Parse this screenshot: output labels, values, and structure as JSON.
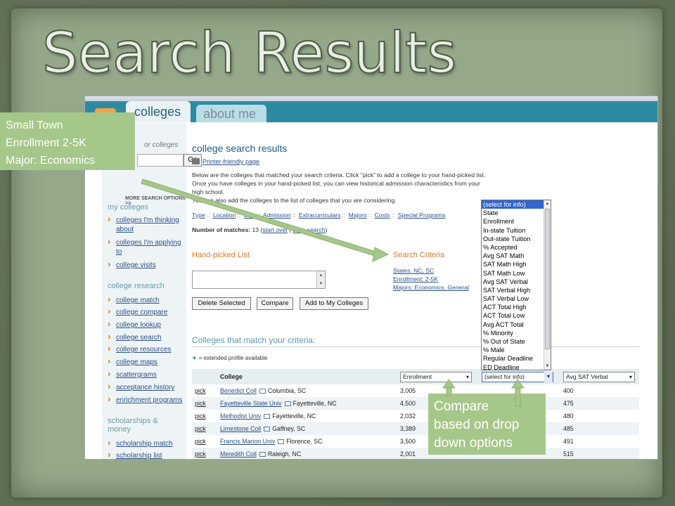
{
  "slide": {
    "title": "Search Results"
  },
  "site": {
    "tabs": [
      {
        "label": "colleges",
        "active": true
      },
      {
        "label": "about me",
        "active": false
      }
    ]
  },
  "sidebar": {
    "search_label": "or colleges",
    "go_label": "Go",
    "more_options": "MORE SEARCH OPTIONS >>",
    "my_colleges_head": "my colleges",
    "my_colleges": [
      {
        "lines": [
          "colleges I'm thinking",
          "about"
        ]
      },
      {
        "lines": [
          "colleges I'm applying",
          "to"
        ]
      },
      {
        "lines": [
          "college visits"
        ]
      }
    ],
    "research_head": "college research",
    "research_items": [
      "college match",
      "college compare",
      "college lookup",
      "college search",
      "college resources",
      "college maps",
      "scattergrams",
      "acceptance history",
      "enrichment programs"
    ],
    "scholarships_head": [
      "scholarships &",
      "money"
    ],
    "scholarship_items": [
      "scholarship match",
      "scholarship list"
    ]
  },
  "main": {
    "title": "college search results",
    "printer_label": "Printer-friendly page",
    "intro_text": "Below are the colleges that matched your search criteria. Click \"pick\" to add a college to your hand-picked list. Once you have colleges in your hand-picked list, you can view historical admission characteristics from your high school.",
    "intro_text_2": "You can also add the colleges to the list of colleges that you are considering.",
    "nav_links": [
      "Type",
      "Location",
      "Size",
      "Admission",
      "Extracurriculars",
      "Majors",
      "Costs",
      "Special Programs"
    ],
    "matches_label": "Number of matches:",
    "matches_value": "13",
    "start_over": "start over",
    "save_search": "save search",
    "handpicked_title": "Hand-picked List",
    "criteria_title": "Search Criteria",
    "criteria": [
      "States: NC, SC",
      "Enrollment: 2-5K",
      "Majors: Economics, General"
    ],
    "buttons": {
      "delete": "Delete Selected",
      "compare": "Compare",
      "add": "Add to My Colleges"
    },
    "match_title": "Colleges that match your criteria:",
    "extended_note": "= extended profile available"
  },
  "table": {
    "col_college": "College",
    "col_select_1": "Enrollment",
    "col_select_2": "(select for info)",
    "col_select_3": "Avg SAT Verbal",
    "pick_label": "pick",
    "rows": [
      {
        "name": "Benedict Coll",
        "location": "Columbia, SC",
        "enrollment": "3,005",
        "sat": "400"
      },
      {
        "name": "Fayetteville State Univ",
        "location": "Fayetteville, NC",
        "enrollment": "4,500",
        "sat": "475"
      },
      {
        "name": "Methodist Univ",
        "location": "Fayetteville, NC",
        "enrollment": "2,032",
        "sat": "480"
      },
      {
        "name": "Limestone Coll",
        "location": "Gaffney, SC",
        "enrollment": "3,389",
        "sat": "485"
      },
      {
        "name": "Francis Marion Univ",
        "location": "Florence, SC",
        "enrollment": "3,500",
        "sat": "491"
      },
      {
        "name": "Meredith Coll",
        "location": "Raleigh, NC",
        "enrollment": "2,001",
        "sat": "515"
      }
    ]
  },
  "dropdown": {
    "selected": "(select for info)",
    "options": [
      "(select for info)",
      "State",
      "Enrollment",
      "In-state Tuition",
      "Out-state Tuition",
      "% Accepted",
      "Avg SAT Math",
      "SAT Math High",
      "SAT Math Low",
      "Avg SAT Verbal",
      "SAT Verbal High",
      "SAT Verbal Low",
      "ACT Total High",
      "ACT Total Low",
      "Avg ACT Total",
      "% Minority",
      "% Out of State",
      "% Male",
      "Regular Deadline",
      "ED Deadline"
    ]
  },
  "callouts": {
    "left": [
      "Small Town",
      "Enrollment 2-5K",
      "Major: Economics"
    ],
    "right": [
      "Compare",
      "based on drop",
      "down options"
    ]
  },
  "colors": {
    "slide_bg": "#95a88a",
    "callout_bg": "#a6c78a",
    "tab_bar": "#2d8aa0",
    "link": "#2a4f8a",
    "accent_orange": "#d9782a"
  }
}
